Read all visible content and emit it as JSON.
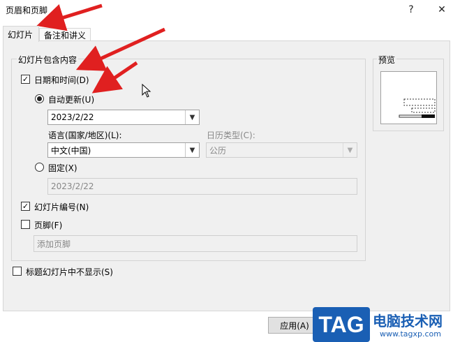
{
  "window": {
    "title": "页眉和页脚",
    "help": "?",
    "close": "✕"
  },
  "tabs": [
    {
      "label": "幻灯片"
    },
    {
      "label": "备注和讲义"
    }
  ],
  "slide_group": {
    "title": "幻灯片包含内容",
    "date_time": {
      "label": "日期和时间(D)",
      "checked": "✓"
    },
    "auto_update": {
      "label": "自动更新(U)",
      "date_value": "2023/2/22"
    },
    "language": {
      "label": "语言(国家/地区)(L):",
      "value": "中文(中国)"
    },
    "calendar": {
      "label": "日历类型(C):",
      "value": "公历"
    },
    "fixed": {
      "label": "固定(X)",
      "value": "2023/2/22"
    },
    "slide_number": {
      "label": "幻灯片编号(N)",
      "checked": "✓"
    },
    "footer": {
      "label": "页脚(F)",
      "placeholder": "添加页脚"
    }
  },
  "preview": {
    "title": "预览"
  },
  "hide_on_title": {
    "label": "标题幻灯片中不显示(S)"
  },
  "buttons": {
    "apply": "应用(A)"
  },
  "watermark": {
    "logo": "TAG",
    "site_name": "电脑技术网",
    "url": "www.tagxp.com"
  },
  "colors": {
    "arrow": "#e02020",
    "watermark_blue": "#1a5fb4"
  }
}
